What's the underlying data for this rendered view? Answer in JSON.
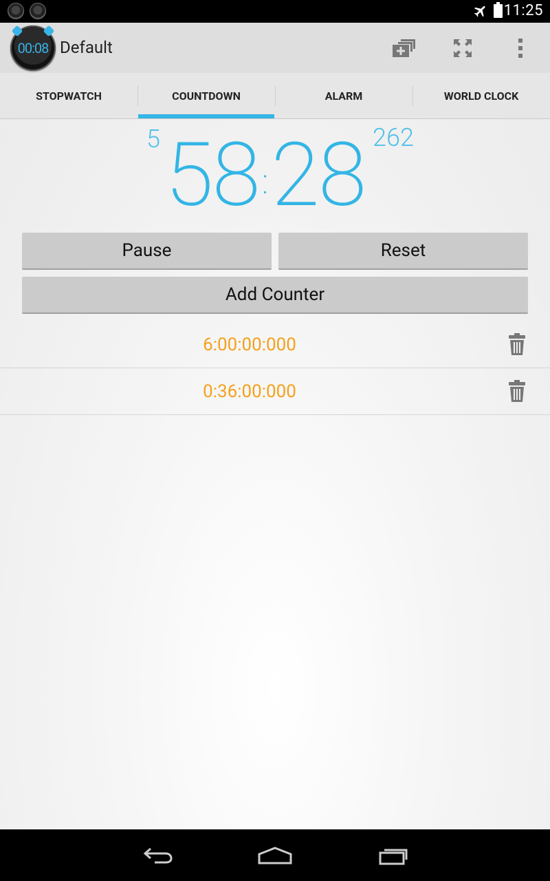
{
  "status_bar": {
    "time": "11:25",
    "icons": [
      "notification-icon",
      "notification-icon",
      "airplane-mode-icon",
      "battery-icon"
    ]
  },
  "action_bar": {
    "app_icon_text": "00:08",
    "title": "Default",
    "actions": [
      "add-window-icon",
      "fullscreen-icon",
      "overflow-menu-icon"
    ]
  },
  "tabs": [
    {
      "label": "STOPWATCH",
      "active": false
    },
    {
      "label": "COUNTDOWN",
      "active": true
    },
    {
      "label": "ALARM",
      "active": false
    },
    {
      "label": "WORLD CLOCK",
      "active": false
    }
  ],
  "countdown": {
    "hours": "5",
    "minutes": "58",
    "seconds": "28",
    "millis": "262"
  },
  "buttons": {
    "pause": "Pause",
    "reset": "Reset",
    "add_counter": "Add Counter"
  },
  "counters": [
    {
      "value": "6:00:00:000"
    },
    {
      "value": "0:36:00:000"
    }
  ],
  "colors": {
    "accent": "#33b5e5",
    "counter_text": "#f5a11e"
  },
  "nav_bar": [
    "back-icon",
    "home-icon",
    "recent-apps-icon"
  ]
}
